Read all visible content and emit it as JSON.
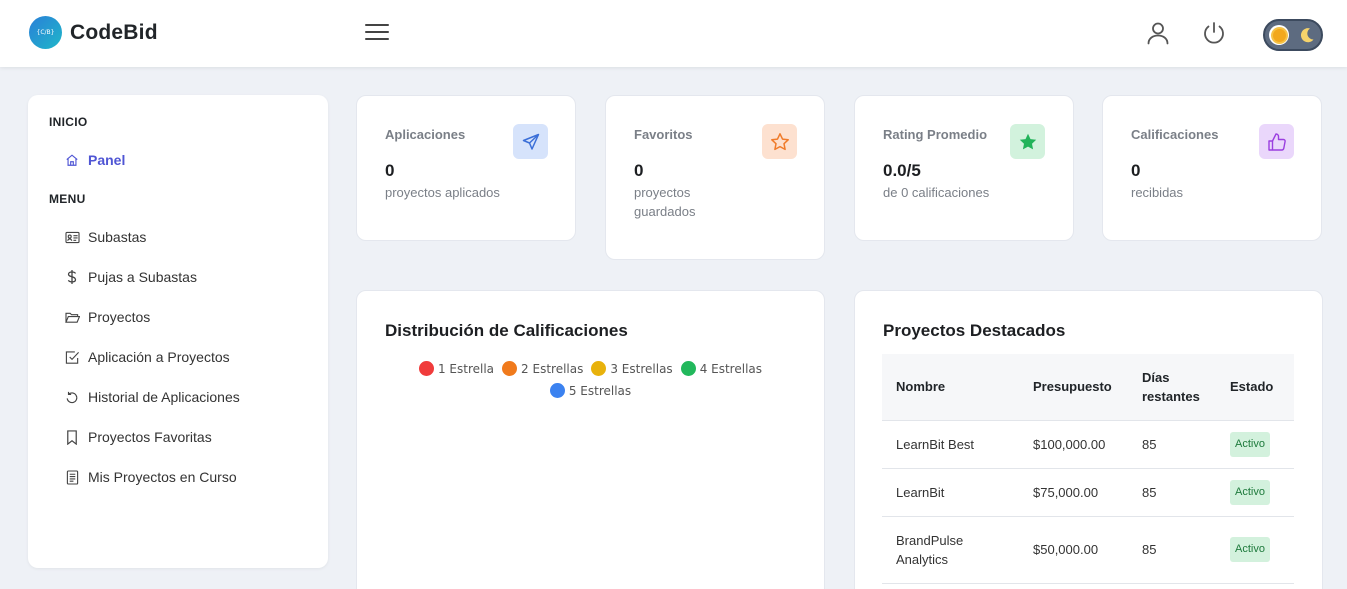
{
  "header": {
    "logo_badge": "{C/B}",
    "app_name": "CodeBid"
  },
  "sidebar": {
    "inicio_title": "INICIO",
    "panel_label": "Panel",
    "menu_title": "MENU",
    "items": [
      {
        "label": "Subastas",
        "icon": "id-card-icon"
      },
      {
        "label": "Pujas a Subastas",
        "icon": "dollar-icon"
      },
      {
        "label": "Proyectos",
        "icon": "folder-icon"
      },
      {
        "label": "Aplicación a Proyectos",
        "icon": "check-square-icon"
      },
      {
        "label": "Historial de Aplicaciones",
        "icon": "history-icon"
      },
      {
        "label": "Proyectos Favoritas",
        "icon": "bookmark-icon"
      },
      {
        "label": "Mis Proyectos en Curso",
        "icon": "document-icon"
      }
    ]
  },
  "stats": [
    {
      "label": "Aplicaciones",
      "value": "0",
      "sub": "proyectos aplicados",
      "icon": "send-icon",
      "color": "#3b6fd8",
      "bg": "#d6e3fb"
    },
    {
      "label": "Favoritos",
      "value": "0",
      "sub": "proyectos guardados",
      "icon": "star-outline-icon",
      "color": "#f07b2a",
      "bg": "#fde1d0"
    },
    {
      "label": "Rating Promedio",
      "value": "0.0/5",
      "sub": "de 0 calificaciones",
      "icon": "star-filled-icon",
      "color": "#22b35a",
      "bg": "#d2f2dd"
    },
    {
      "label": "Calificaciones",
      "value": "0",
      "sub": "recibidas",
      "icon": "thumbs-up-icon",
      "color": "#9b3fe0",
      "bg": "#ead7fb"
    }
  ],
  "ratings_panel": {
    "title": "Distribución de Calificaciones",
    "legend": [
      {
        "label": "1 Estrella",
        "color": "#f03b3b"
      },
      {
        "label": "2 Estrellas",
        "color": "#f07a1c"
      },
      {
        "label": "3 Estrellas",
        "color": "#e8b20c"
      },
      {
        "label": "4 Estrellas",
        "color": "#22b85c"
      },
      {
        "label": "5 Estrellas",
        "color": "#3b82f0"
      }
    ]
  },
  "featured_panel": {
    "title": "Proyectos Destacados",
    "columns": [
      "Nombre",
      "Presupuesto",
      "Días restantes",
      "Estado"
    ],
    "rows": [
      {
        "name": "LearnBit Best",
        "budget": "$100,000.00",
        "days": "85",
        "status": "Activo"
      },
      {
        "name": "LearnBit",
        "budget": "$75,000.00",
        "days": "85",
        "status": "Activo"
      },
      {
        "name": "BrandPulse Analytics",
        "budget": "$50,000.00",
        "days": "85",
        "status": "Activo"
      }
    ]
  }
}
